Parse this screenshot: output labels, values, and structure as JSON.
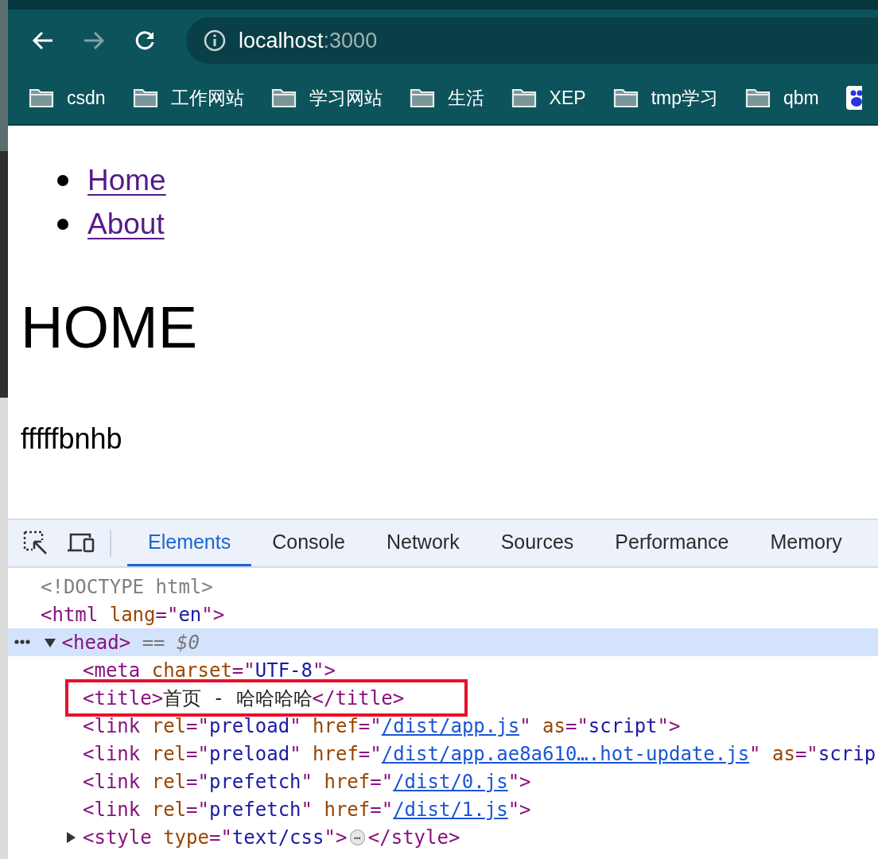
{
  "browser": {
    "address": {
      "host": "localhost",
      "port": ":3000"
    },
    "bookmarks": [
      {
        "kind": "folder",
        "label": "csdn"
      },
      {
        "kind": "folder",
        "label": "工作网站"
      },
      {
        "kind": "folder",
        "label": "学习网站"
      },
      {
        "kind": "folder",
        "label": "生活"
      },
      {
        "kind": "folder",
        "label": "XEP"
      },
      {
        "kind": "folder",
        "label": "tmp学习"
      },
      {
        "kind": "folder",
        "label": "qbm"
      },
      {
        "kind": "site"
      }
    ]
  },
  "page": {
    "nav_links": [
      "Home",
      "About"
    ],
    "heading": "HOME",
    "paragraph": "fffffbnhb"
  },
  "devtools": {
    "tabs": [
      {
        "label": "Elements",
        "selected": true
      },
      {
        "label": "Console",
        "selected": false
      },
      {
        "label": "Network",
        "selected": false
      },
      {
        "label": "Sources",
        "selected": false
      },
      {
        "label": "Performance",
        "selected": false
      },
      {
        "label": "Memory",
        "selected": false
      }
    ],
    "tree": [
      {
        "tokens": [
          {
            "kind": "doctype",
            "text": "<!DOCTYPE html>"
          }
        ]
      },
      {
        "tokens": [
          {
            "kind": "tag",
            "text": "<html "
          },
          {
            "kind": "attr",
            "text": "lang"
          },
          {
            "kind": "tag",
            "text": "=\""
          },
          {
            "kind": "value",
            "text": "en"
          },
          {
            "kind": "tag",
            "text": "\">"
          }
        ],
        "children": [
          {
            "expanded": true,
            "selected": true,
            "tokens": [
              {
                "kind": "tag",
                "text": "<head>"
              },
              {
                "kind": "marker",
                "text": " == $0"
              }
            ],
            "children": [
              {
                "tokens": [
                  {
                    "kind": "tag",
                    "text": "<meta "
                  },
                  {
                    "kind": "attr",
                    "text": "charset"
                  },
                  {
                    "kind": "tag",
                    "text": "=\""
                  },
                  {
                    "kind": "value",
                    "text": "UTF-8"
                  },
                  {
                    "kind": "tag",
                    "text": "\">"
                  }
                ]
              },
              {
                "highlighted": true,
                "tokens": [
                  {
                    "kind": "tag",
                    "text": "<title>"
                  },
                  {
                    "kind": "text",
                    "text": "首页 - 哈哈哈哈"
                  },
                  {
                    "kind": "tag",
                    "text": "</title>"
                  }
                ]
              },
              {
                "tokens": [
                  {
                    "kind": "tag",
                    "text": "<link "
                  },
                  {
                    "kind": "attr",
                    "text": "rel"
                  },
                  {
                    "kind": "tag",
                    "text": "=\""
                  },
                  {
                    "kind": "value",
                    "text": "preload"
                  },
                  {
                    "kind": "tag",
                    "text": "\" "
                  },
                  {
                    "kind": "attr",
                    "text": "href"
                  },
                  {
                    "kind": "tag",
                    "text": "=\""
                  },
                  {
                    "kind": "link",
                    "text": "/dist/app.js"
                  },
                  {
                    "kind": "tag",
                    "text": "\" "
                  },
                  {
                    "kind": "attr",
                    "text": "as"
                  },
                  {
                    "kind": "tag",
                    "text": "=\""
                  },
                  {
                    "kind": "value",
                    "text": "script"
                  },
                  {
                    "kind": "tag",
                    "text": "\">"
                  }
                ]
              },
              {
                "tokens": [
                  {
                    "kind": "tag",
                    "text": "<link "
                  },
                  {
                    "kind": "attr",
                    "text": "rel"
                  },
                  {
                    "kind": "tag",
                    "text": "=\""
                  },
                  {
                    "kind": "value",
                    "text": "preload"
                  },
                  {
                    "kind": "tag",
                    "text": "\" "
                  },
                  {
                    "kind": "attr",
                    "text": "href"
                  },
                  {
                    "kind": "tag",
                    "text": "=\""
                  },
                  {
                    "kind": "link",
                    "text": "/dist/app.ae8a610….hot-update.js"
                  },
                  {
                    "kind": "tag",
                    "text": "\" "
                  },
                  {
                    "kind": "attr",
                    "text": "as"
                  },
                  {
                    "kind": "tag",
                    "text": "=\""
                  },
                  {
                    "kind": "value",
                    "text": "scrip"
                  }
                ]
              },
              {
                "tokens": [
                  {
                    "kind": "tag",
                    "text": "<link "
                  },
                  {
                    "kind": "attr",
                    "text": "rel"
                  },
                  {
                    "kind": "tag",
                    "text": "=\""
                  },
                  {
                    "kind": "value",
                    "text": "prefetch"
                  },
                  {
                    "kind": "tag",
                    "text": "\" "
                  },
                  {
                    "kind": "attr",
                    "text": "href"
                  },
                  {
                    "kind": "tag",
                    "text": "=\""
                  },
                  {
                    "kind": "link",
                    "text": "/dist/0.js"
                  },
                  {
                    "kind": "tag",
                    "text": "\">"
                  }
                ]
              },
              {
                "tokens": [
                  {
                    "kind": "tag",
                    "text": "<link "
                  },
                  {
                    "kind": "attr",
                    "text": "rel"
                  },
                  {
                    "kind": "tag",
                    "text": "=\""
                  },
                  {
                    "kind": "value",
                    "text": "prefetch"
                  },
                  {
                    "kind": "tag",
                    "text": "\" "
                  },
                  {
                    "kind": "attr",
                    "text": "href"
                  },
                  {
                    "kind": "tag",
                    "text": "=\""
                  },
                  {
                    "kind": "link",
                    "text": "/dist/1.js"
                  },
                  {
                    "kind": "tag",
                    "text": "\">"
                  }
                ]
              },
              {
                "expanded": false,
                "selected": false,
                "tokens": [
                  {
                    "kind": "tag",
                    "text": "<style "
                  },
                  {
                    "kind": "attr",
                    "text": "type"
                  },
                  {
                    "kind": "tag",
                    "text": "=\""
                  },
                  {
                    "kind": "value",
                    "text": "text/css"
                  },
                  {
                    "kind": "tag",
                    "text": "\">"
                  },
                  {
                    "kind": "badge",
                    "text": "⋯"
                  },
                  {
                    "kind": "tag",
                    "text": "</style>"
                  }
                ]
              }
            ]
          }
        ]
      }
    ]
  }
}
